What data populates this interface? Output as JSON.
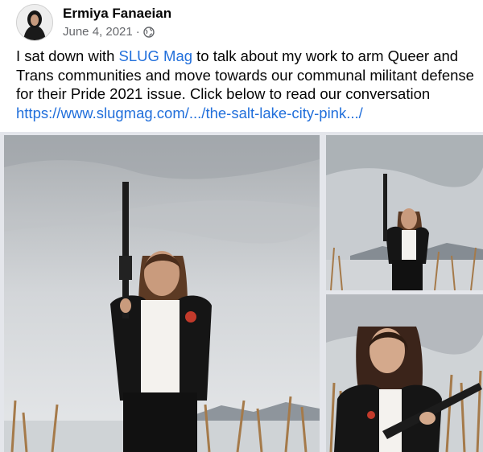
{
  "post": {
    "author": "Ermiya Fanaeian",
    "date": "June 4, 2021",
    "separator": "·",
    "privacy_icon": "globe-icon",
    "text_part1": "I sat down with ",
    "mention": "SLUG Mag",
    "text_part2": " to talk about my work to arm Queer and Trans communities and move towards our communal militant defense for their Pride 2021 issue. Click below to read our conversation",
    "link": "https://www.slugmag.com/.../the-salt-lake-city-pink.../"
  },
  "colors": {
    "link": "#216fdb",
    "meta": "#65676b",
    "text": "#050505"
  },
  "photos": [
    {
      "id": "photo-main",
      "description_icon": "person-with-rifle-image"
    },
    {
      "id": "photo-top-right",
      "description_icon": "person-with-rifle-image"
    },
    {
      "id": "photo-bottom-right",
      "description_icon": "person-with-rifle-image"
    }
  ]
}
